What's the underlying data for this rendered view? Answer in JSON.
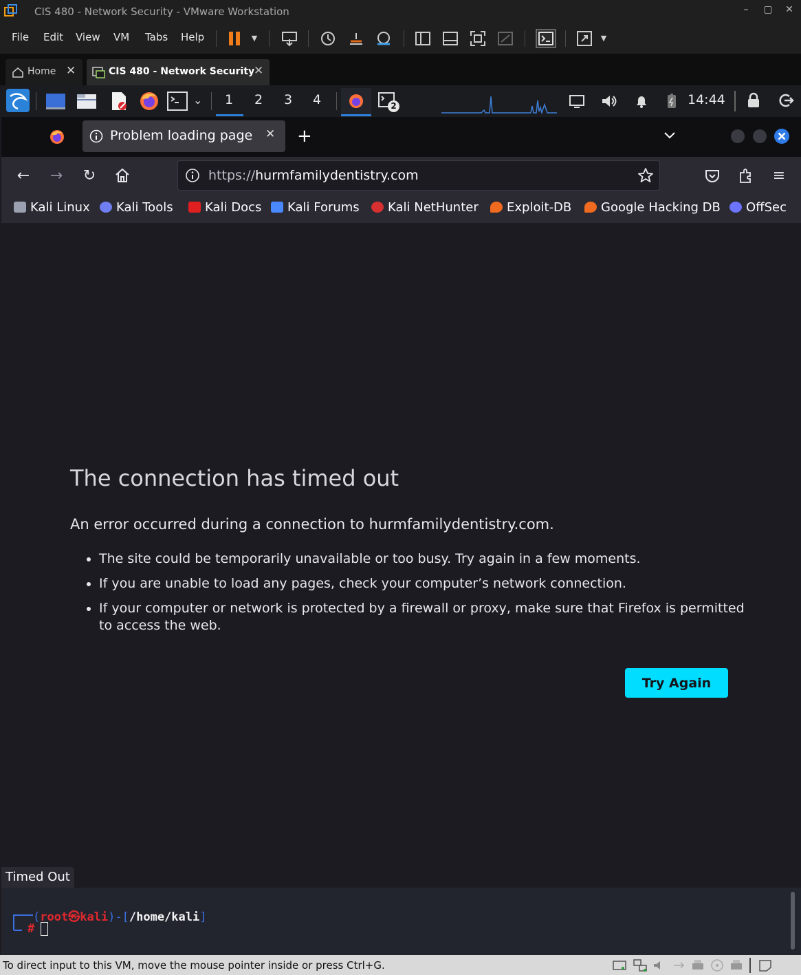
{
  "window": {
    "title": "CIS 480 - Network Security - VMware Workstation",
    "controls": [
      "–",
      "▢",
      "✕"
    ]
  },
  "vm_menu": {
    "items": [
      "File",
      "Edit",
      "View",
      "VM",
      "Tabs",
      "Help"
    ]
  },
  "vm_tabs": [
    {
      "label": "Home",
      "icon": "home-icon",
      "active": false
    },
    {
      "label": "CIS 480 - Network Security",
      "icon": "vm-icon",
      "active": true
    }
  ],
  "kali_panel": {
    "workspaces": [
      "1",
      "2",
      "3",
      "4"
    ],
    "active_workspace": "1",
    "terminal_badge": "2",
    "clock": "14:44"
  },
  "firefox": {
    "tab_title": "Problem loading page",
    "url_prefix": "https://",
    "url_domain": "hurmfamilydentistry.com",
    "bookmarks": [
      {
        "label": "Kali Linux",
        "icon": "kali-dragon-icon",
        "color": "#9aa0b0"
      },
      {
        "label": "Kali Tools",
        "icon": "kali-tools-icon",
        "color": "#6f7ef0"
      },
      {
        "label": "Kali Docs",
        "icon": "kali-docs-icon",
        "color": "#e02020"
      },
      {
        "label": "Kali Forums",
        "icon": "kali-forums-icon",
        "color": "#4a88ff"
      },
      {
        "label": "Kali NetHunter",
        "icon": "nethunter-icon",
        "color": "#d83030"
      },
      {
        "label": "Exploit-DB",
        "icon": "exploit-db-icon",
        "color": "#f06a20"
      },
      {
        "label": "Google Hacking DB",
        "icon": "ghdb-icon",
        "color": "#f06a20"
      },
      {
        "label": "OffSec",
        "icon": "offsec-icon",
        "color": "#6b73ff"
      }
    ]
  },
  "error_page": {
    "title": "The connection has timed out",
    "description": "An error occurred during a connection to hurmfamilydentistry.com.",
    "bullets": [
      "The site could be temporarily unavailable or too busy. Try again in a few moments.",
      "If you are unable to load any pages, check your computer’s network connection.",
      "If your computer or network is protected by a firewall or proxy, make sure that Firefox is permitted to access the web."
    ],
    "button": "Try Again",
    "accent_color": "#00ddff"
  },
  "status_tip": "Timed Out",
  "terminal": {
    "user": "root",
    "at": "㉿",
    "host": "kali",
    "path": "/home/kali",
    "prompt_symbol": "#"
  },
  "vm_status": {
    "message": "To direct input to this VM, move the mouse pointer inside or press Ctrl+G."
  }
}
